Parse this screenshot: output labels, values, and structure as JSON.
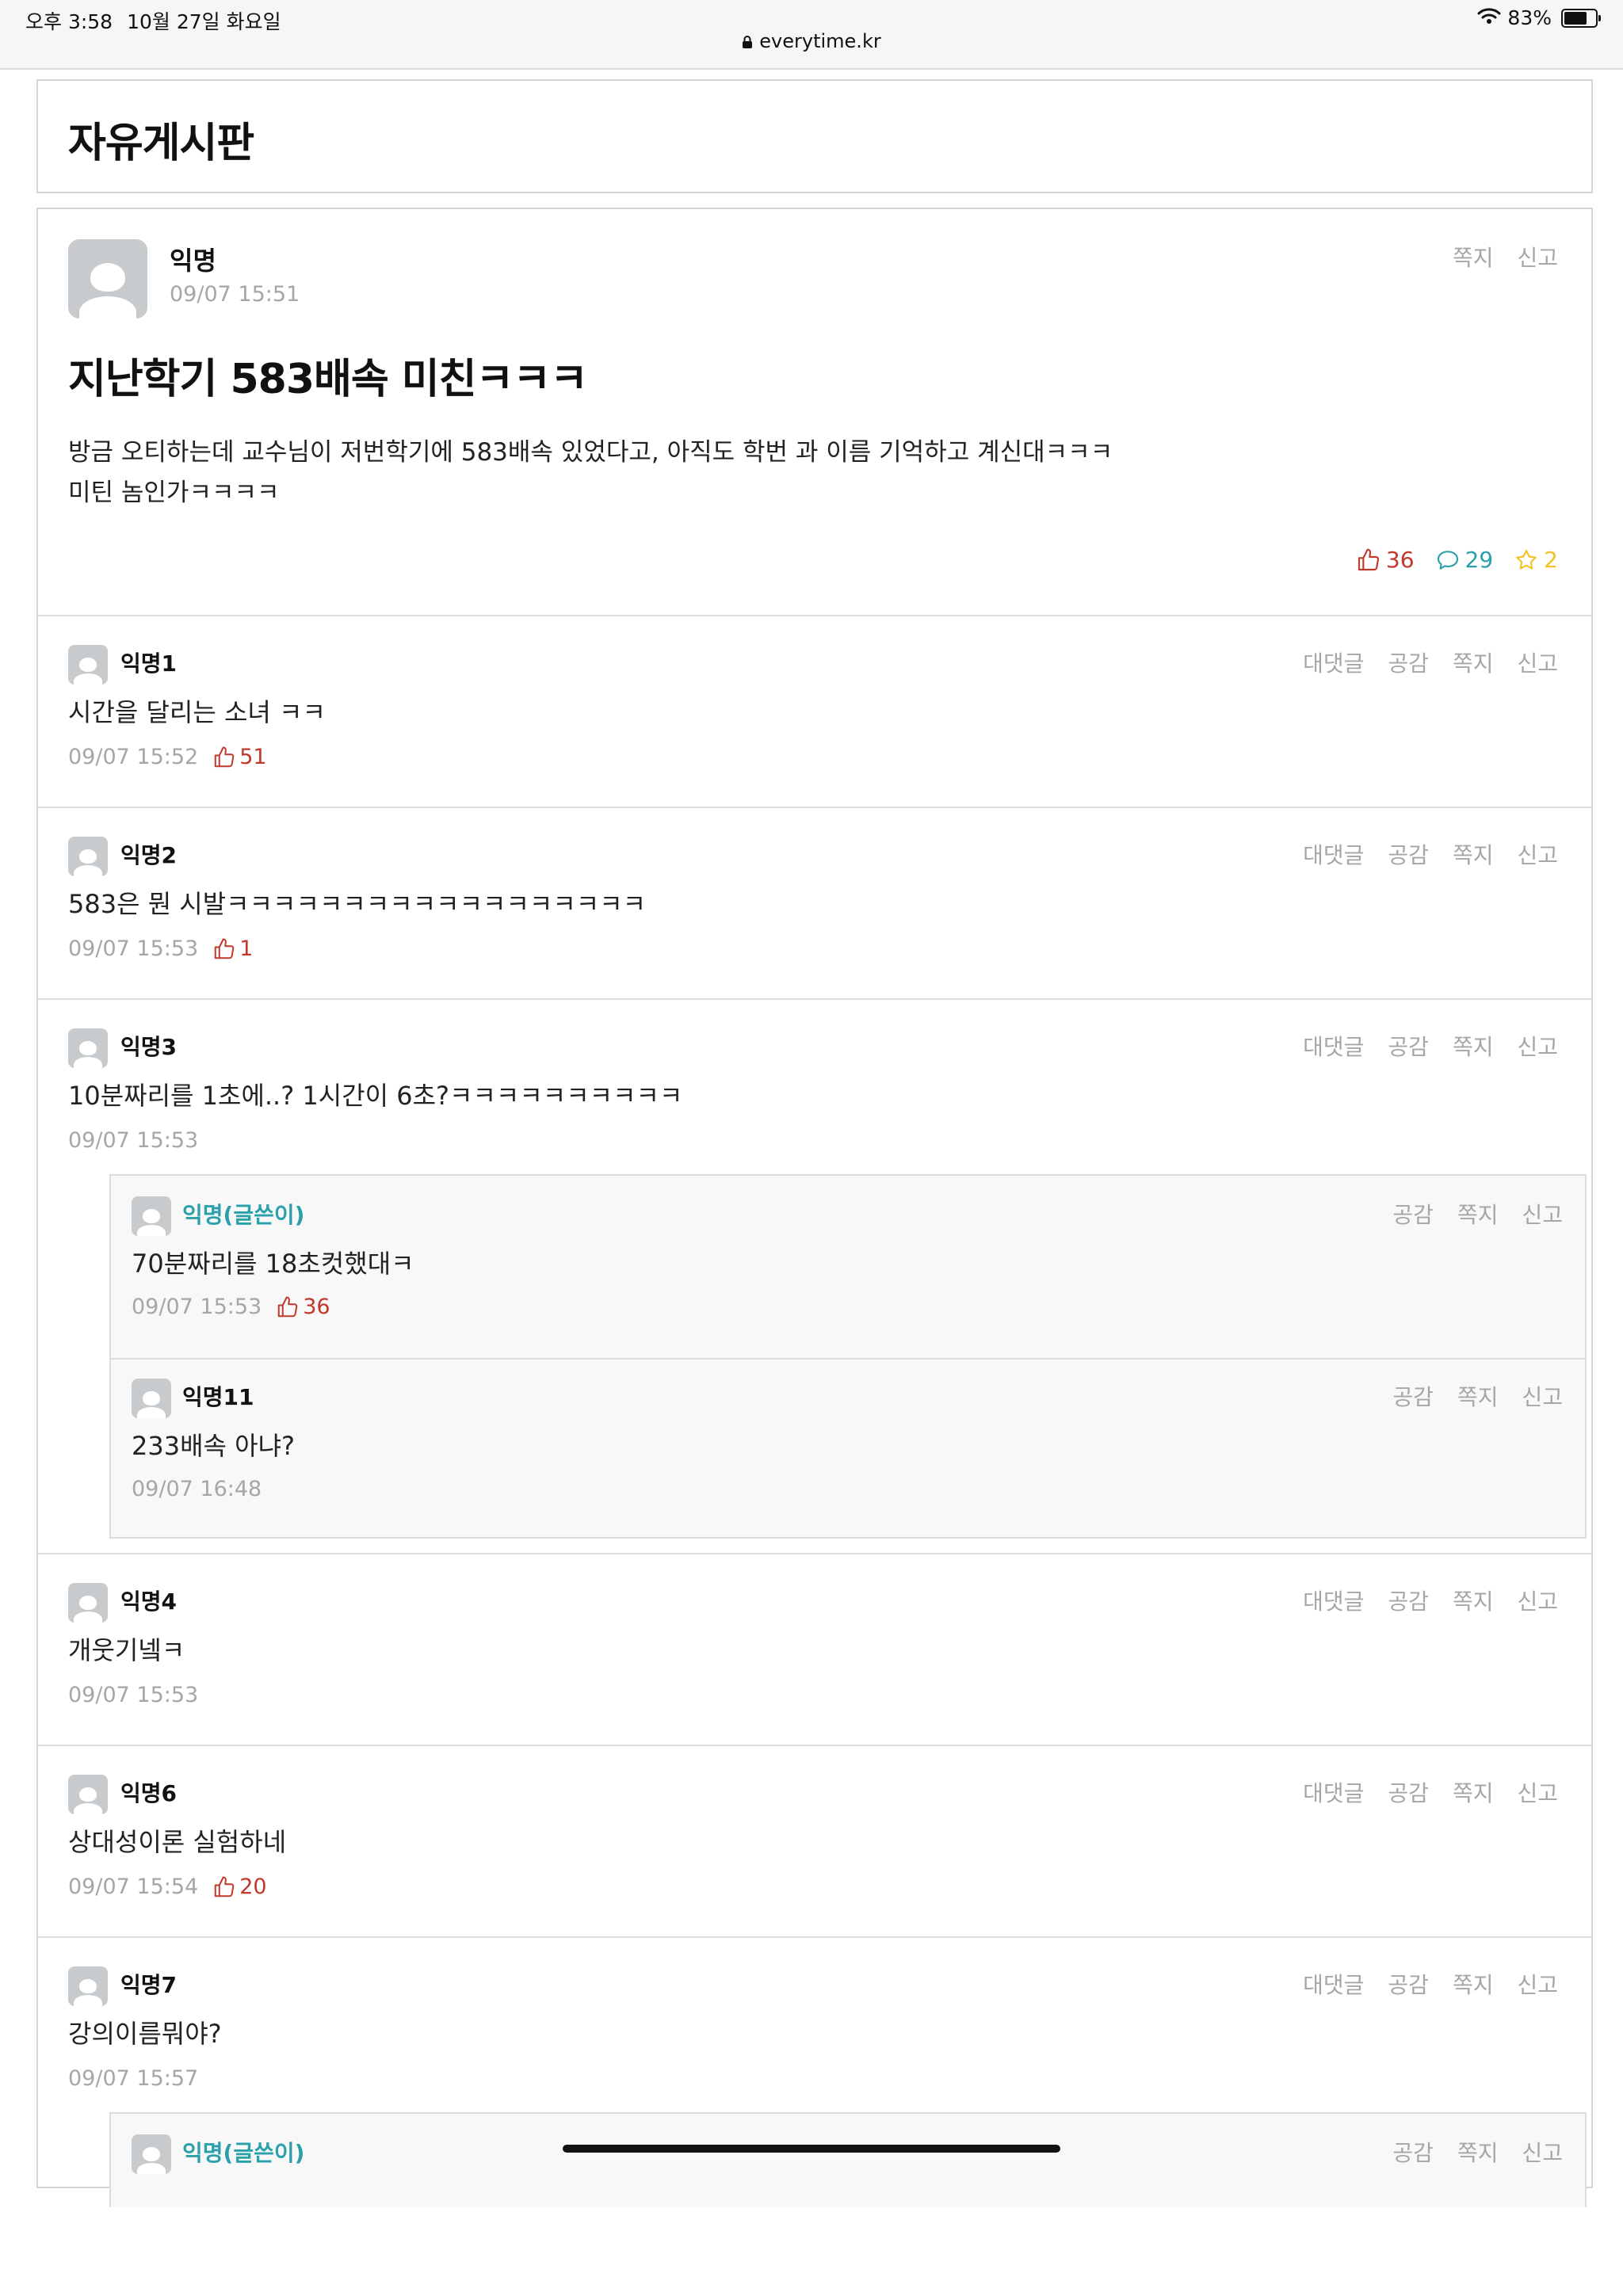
{
  "status_bar": {
    "time": "오후 3:58",
    "date": "10월 27일 화요일",
    "url": "everytime.kr",
    "battery": "83%",
    "battery_level": 0.83
  },
  "board": {
    "title": "자유게시판"
  },
  "article": {
    "author": "익명",
    "time": "09/07 15:51",
    "actions": [
      "쪽지",
      "신고"
    ],
    "title": "지난학기 583배속 미친ㅋㅋㅋ",
    "body_line1": "방금 오티하는데 교수님이 저번학기에 583배속 있었다고, 아직도 학번 과 이름 기억하고 계신대ㅋㅋㅋ",
    "body_line2": "미틴 놈인가ㅋㅋㅋㅋ",
    "likes": "36",
    "comments": "29",
    "scraps": "2"
  },
  "comment_actions": [
    "대댓글",
    "공감",
    "쪽지",
    "신고"
  ],
  "reply_actions": [
    "공감",
    "쪽지",
    "신고"
  ],
  "comments": [
    {
      "author": "익명1",
      "text": "시간을 달리는 소녀 ㅋㅋ",
      "time": "09/07 15:52",
      "likes": "51"
    },
    {
      "author": "익명2",
      "text": "583은 뭔 시발ㅋㅋㅋㅋㅋㅋㅋㅋㅋㅋㅋㅋㅋㅋㅋㅋㅋㅋ",
      "time": "09/07 15:53",
      "likes": "1"
    },
    {
      "author": "익명3",
      "text": "10분짜리를 1초에..? 1시간이 6초?ㅋㅋㅋㅋㅋㅋㅋㅋㅋㅋ",
      "time": "09/07 15:53",
      "likes": ""
    },
    {
      "author": "익명4",
      "text": "개웃기넼ㅋ",
      "time": "09/07 15:53",
      "likes": ""
    },
    {
      "author": "익명6",
      "text": "상대성이론 실험하네",
      "time": "09/07 15:54",
      "likes": "20"
    },
    {
      "author": "익명7",
      "text": "강의이름뭐야?",
      "time": "09/07 15:57",
      "likes": ""
    }
  ],
  "replies_group1": [
    {
      "author": "익명(글쓴이)",
      "text": "70분짜리를 18초컷했대ㅋ",
      "time": "09/07 15:53",
      "likes": "36"
    },
    {
      "author": "익명11",
      "text": "233배속 아냐?",
      "time": "09/07 16:48",
      "likes": ""
    }
  ],
  "replies_group2": [
    {
      "author": "익명(글쓴이)"
    }
  ]
}
